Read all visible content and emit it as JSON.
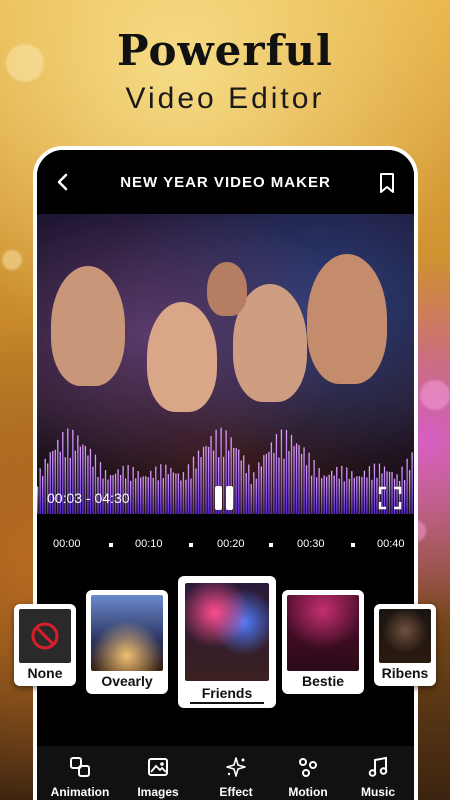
{
  "headline": {
    "title": "Powerful",
    "subtitle": "Video Editor"
  },
  "topbar": {
    "title": "NEW YEAR VIDEO MAKER"
  },
  "player": {
    "time": "00:03 - 04:30"
  },
  "timeline": {
    "ticks": [
      "00:00",
      "00:10",
      "00:20",
      "00:30",
      "00:40"
    ]
  },
  "themes": [
    {
      "label": "None"
    },
    {
      "label": "Ovearly"
    },
    {
      "label": "Friends"
    },
    {
      "label": "Bestie"
    },
    {
      "label": "Ribens"
    }
  ],
  "toolbar": [
    {
      "label": "Animation",
      "icon": "animation-icon"
    },
    {
      "label": "Images",
      "icon": "images-icon"
    },
    {
      "label": "Effect",
      "icon": "effect-icon"
    },
    {
      "label": "Motion",
      "icon": "motion-icon"
    },
    {
      "label": "Music",
      "icon": "music-icon"
    }
  ],
  "colors": {
    "none_icon": "#d81e2c",
    "wave_top": "#e0a0ff",
    "wave_bottom": "#5a2bd6"
  }
}
